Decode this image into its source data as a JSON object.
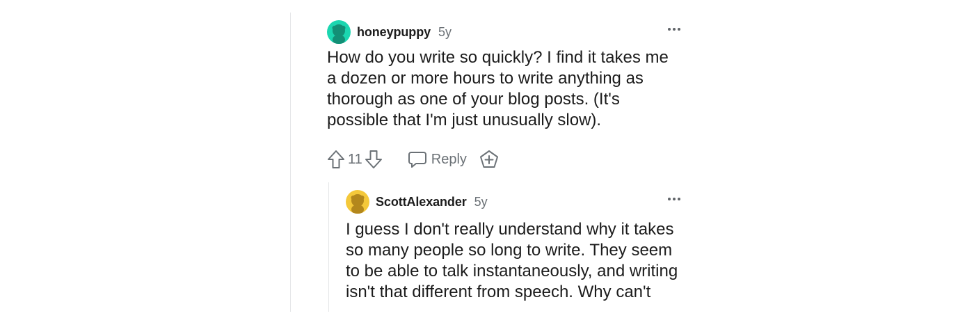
{
  "comments": [
    {
      "username": "honeypuppy",
      "age": "5y",
      "body": "How do you write so quickly? I find it takes me a dozen or more hours to write anything as thorough as one of your blog posts. (It's possible that I'm just unusually slow).",
      "votes": "11",
      "reply_label": "Reply",
      "avatar_color": "#1bd6b0"
    },
    {
      "username": "ScottAlexander",
      "age": "5y",
      "body": "I guess I don't really understand why it takes so many people so long to write. They seem to be able to talk instantaneously, and writing isn't that different from speech. Why can't they just",
      "avatar_color": "#f4c83a"
    }
  ],
  "icons": {
    "upvote": "arrow-up-icon",
    "downvote": "arrow-down-icon",
    "reply": "speech-bubble-icon",
    "award": "award-plus-icon",
    "more": "more-horizontal-icon"
  }
}
